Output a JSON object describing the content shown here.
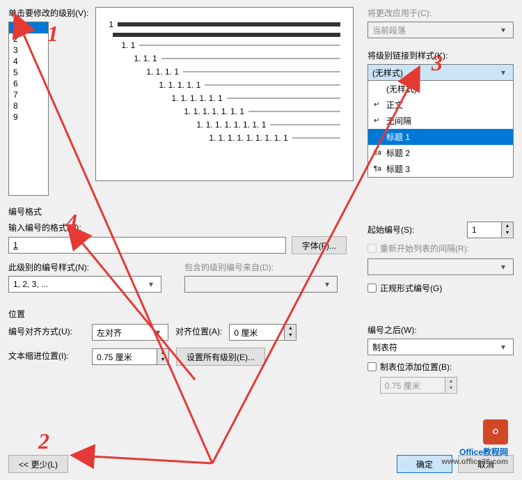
{
  "topLeft": {
    "label": "单击要修改的级别(V):",
    "levels": [
      "1",
      "2",
      "3",
      "4",
      "5",
      "6",
      "7",
      "8",
      "9"
    ],
    "selected": "1"
  },
  "preview": {
    "lines": [
      {
        "indent": 0,
        "num": "1",
        "thick": true
      },
      {
        "indent": 0,
        "num": "",
        "thick": true
      },
      {
        "indent": 1,
        "num": "1. 1"
      },
      {
        "indent": 2,
        "num": "1. 1. 1"
      },
      {
        "indent": 3,
        "num": "1. 1. 1. 1"
      },
      {
        "indent": 4,
        "num": "1. 1. 1. 1. 1"
      },
      {
        "indent": 5,
        "num": "1. 1. 1. 1. 1. 1"
      },
      {
        "indent": 6,
        "num": "1. 1. 1. 1. 1. 1. 1"
      },
      {
        "indent": 7,
        "num": "1. 1. 1. 1. 1. 1. 1. 1"
      },
      {
        "indent": 8,
        "num": "1. 1. 1. 1. 1. 1. 1. 1. 1"
      }
    ]
  },
  "applyTo": {
    "label": "将更改应用于(C):",
    "value": "当前段落"
  },
  "linkStyle": {
    "label": "将级别链接到样式(K):",
    "value": "(无样式)",
    "options": [
      {
        "icon": "",
        "text": "(无样式)"
      },
      {
        "icon": "↵",
        "text": "正文"
      },
      {
        "icon": "↵",
        "text": "无间隔"
      },
      {
        "icon": "",
        "text": "标题 1",
        "selected": true
      },
      {
        "icon": "¶a",
        "text": "标题 2"
      },
      {
        "icon": "¶a",
        "text": "标题 3"
      }
    ]
  },
  "numFormat": {
    "section": "编号格式",
    "inputLabel": "输入编号的格式(O):",
    "inputValue": "1",
    "fontBtn": "字体(F)...",
    "styleLabel": "此级别的编号样式(N):",
    "styleValue": "1, 2, 3, ...",
    "includeLabel": "包含的级别编号来自(D):",
    "includeValue": ""
  },
  "startAt": {
    "label": "起始编号(S):",
    "value": "1"
  },
  "restartCheck": "重新开始列表的间隔(R):",
  "restartCombo": "",
  "formalCheck": "正规形式编号(G)",
  "position": {
    "section": "位置",
    "alignLabel": "编号对齐方式(U):",
    "alignValue": "左对齐",
    "alignAtLabel": "对齐位置(A):",
    "alignAtValue": "0 厘米",
    "indentLabel": "文本缩进位置(I):",
    "indentValue": "0.75 厘米",
    "setAllBtn": "设置所有级别(E)..."
  },
  "followNum": {
    "label": "编号之后(W):",
    "value": "制表符"
  },
  "tabStop": {
    "check": "制表位添加位置(B):",
    "value": "0.75 厘米"
  },
  "buttons": {
    "less": "<< 更少(L)",
    "ok": "确定",
    "cancel": "取消"
  },
  "watermark": {
    "text": "Office教程网",
    "url": "www.office26.com"
  },
  "annotations": {
    "a1": "1",
    "a2": "2",
    "a3": "3",
    "a4": "4"
  }
}
